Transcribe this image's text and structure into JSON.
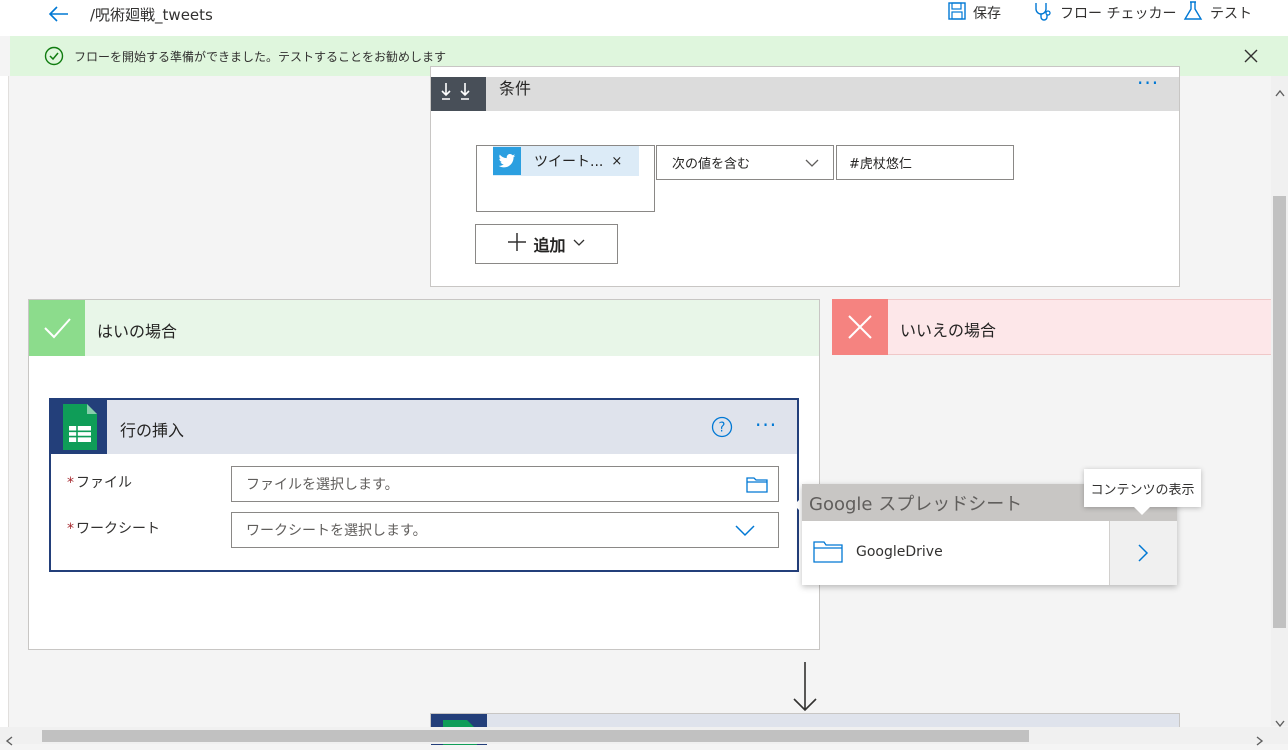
{
  "header": {
    "flow_title": "/呪術廻戦_tweets",
    "save_label": "保存",
    "checker_label": "フロー チェッカー",
    "test_label": "テスト"
  },
  "banner": {
    "message": "フローを開始する準備ができました。テストすることをお勧めします"
  },
  "condition": {
    "title": "条件",
    "token_label": "ツイート...",
    "token_remove": "×",
    "operator": "次の値を含む",
    "value": "#虎杖悠仁",
    "add_label": "追加",
    "menu": "···"
  },
  "yes_branch": {
    "title": "はいの場合"
  },
  "no_branch": {
    "title": "いいえの場合"
  },
  "insert_row": {
    "title": "行の挿入",
    "menu": "···",
    "required_mark": "*",
    "fields": [
      {
        "label": "ファイル",
        "placeholder": "ファイルを選択します。"
      },
      {
        "label": "ワークシート",
        "placeholder": "ワークシートを選択します。"
      }
    ]
  },
  "google_popup": {
    "header": "Google スプレッドシート",
    "item_label": "GoogleDrive"
  },
  "tooltip": {
    "text": "コンテンツの表示"
  },
  "colors": {
    "accent": "#0078d4",
    "banner_bg": "#dff6dd",
    "success": "#107c10",
    "yes_icon_bg": "#8cdc8c",
    "no_icon_bg": "#f58380",
    "card_border": "#233f7a",
    "sheets_green": "#0f9d58",
    "twitter_blue": "#2b9fe0"
  },
  "icons": {
    "back": "back-arrow-icon",
    "save": "save-icon",
    "checker": "stethoscope-icon",
    "test": "flask-icon",
    "banner_check": "check-circle-icon",
    "banner_close": "close-icon",
    "condition": "condition-icon",
    "twitter": "twitter-icon",
    "sheets": "google-sheets-icon",
    "folder": "folder-icon",
    "chevron": "chevron-down-icon"
  }
}
